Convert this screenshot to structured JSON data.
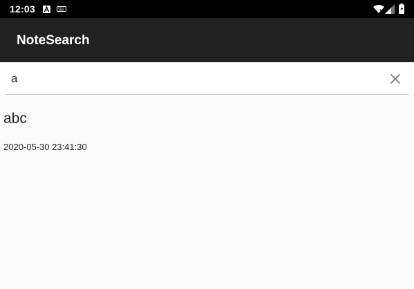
{
  "status_bar": {
    "time": "12:03",
    "icons": [
      "notification-a-icon",
      "keyboard-icon",
      "wifi-icon",
      "cell-signal-icon",
      "battery-icon"
    ]
  },
  "app_bar": {
    "title": "NoteSearch"
  },
  "search": {
    "value": "a",
    "clear_icon": "close-icon"
  },
  "results": [
    {
      "title": "abc",
      "timestamp": "2020-05-30 23:41:30"
    }
  ],
  "colors": {
    "status_bar_bg": "#000000",
    "app_bar_bg": "#212121",
    "page_bg": "#fafafa",
    "text": "#222222"
  }
}
